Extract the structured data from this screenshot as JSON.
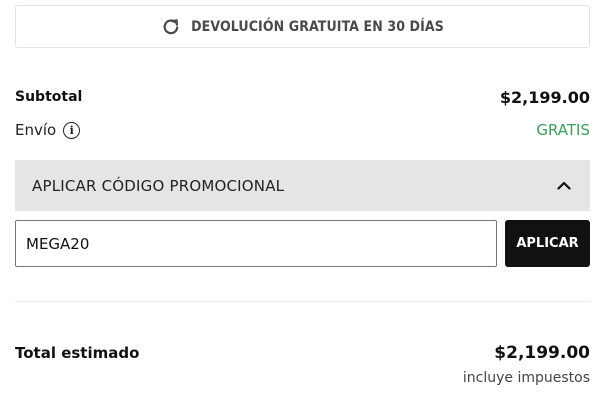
{
  "returns_banner": {
    "icon": "refresh-icon",
    "label": "DEVOLUCIÓN GRATUITA EN 30 DÍAS"
  },
  "summary": {
    "subtotal_label": "Subtotal",
    "subtotal_value": "$2,199.00",
    "shipping_label": "Envío",
    "shipping_value": "GRATIS",
    "shipping_value_color": "#3c9d5d",
    "info_icon": "info-icon"
  },
  "promo": {
    "header_label": "APLICAR CÓDIGO PROMOCIONAL",
    "chevron_icon": "chevron-up-icon",
    "input_value": "MEGA20",
    "apply_label": "APLICAR"
  },
  "total": {
    "label": "Total estimado",
    "value": "$2,199.00",
    "tax_note": "incluye impuestos"
  }
}
